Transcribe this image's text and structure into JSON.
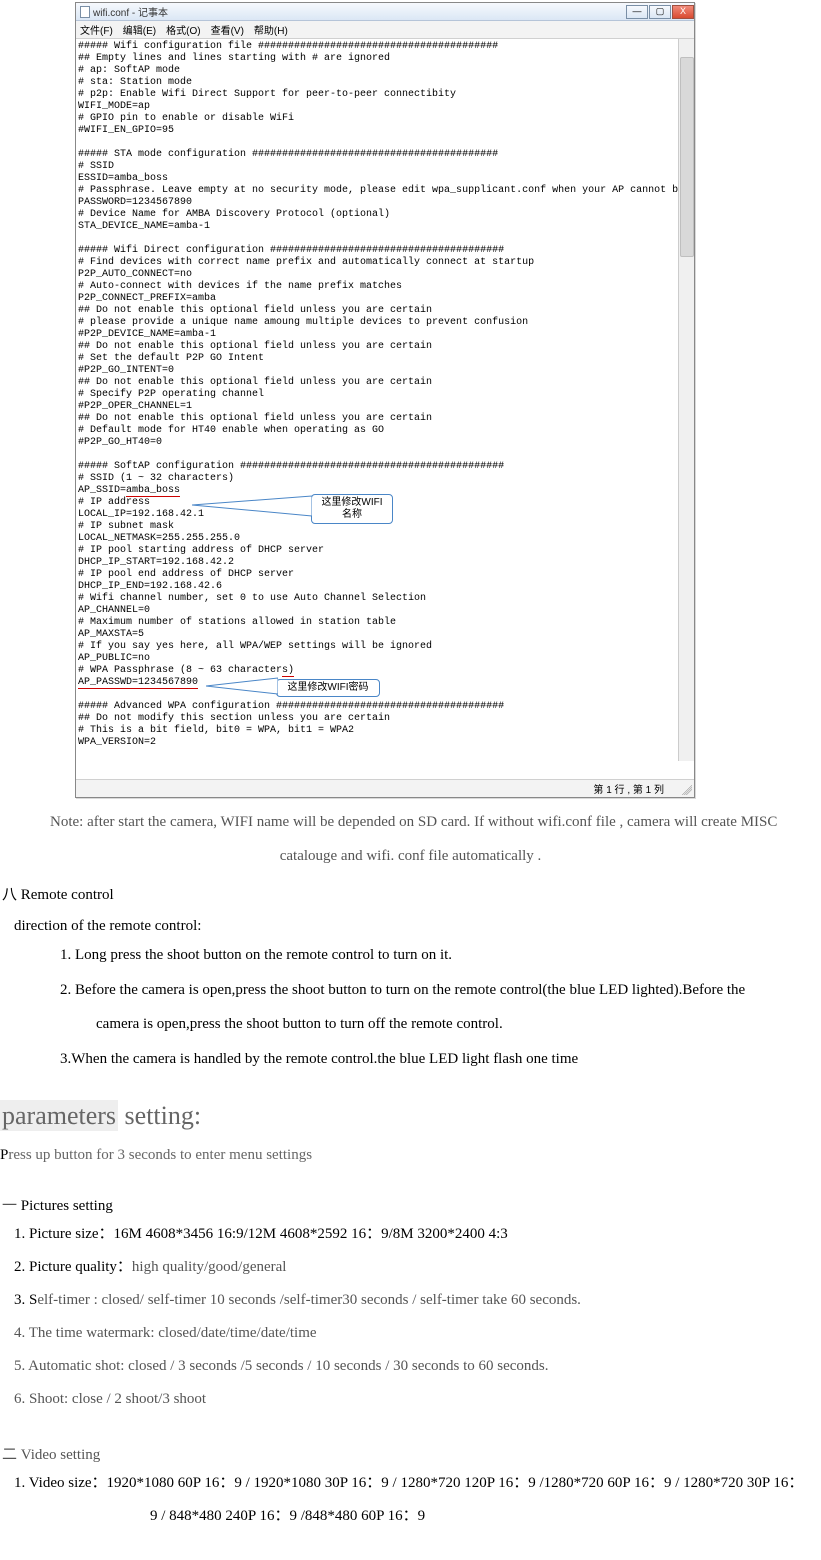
{
  "notepad": {
    "title": "wifi.conf - 记事本",
    "menu": [
      "文件(F)",
      "编辑(E)",
      "格式(O)",
      "查看(V)",
      "帮助(H)"
    ],
    "window_buttons": {
      "min": "—",
      "max": "▢",
      "close": "X"
    },
    "status": "第 1 行 , 第 1 列",
    "callout1": "这里修改WIFI名称",
    "callout2": "这里修改WIFI密码",
    "content_lines": [
      "##### Wifi configuration file ########################################",
      "## Empty lines and lines starting with # are ignored",
      "# ap: SoftAP mode",
      "# sta: Station mode",
      "# p2p: Enable Wifi Direct Support for peer-to-peer connectibity",
      "WIFI_MODE=ap",
      "# GPIO pin to enable or disable WiFi",
      "#WIFI_EN_GPIO=95",
      "",
      "##### STA mode configuration #########################################",
      "# SSID",
      "ESSID=amba_boss",
      "# Passphrase. Leave empty at no security mode, please edit wpa_supplicant.conf when your AP cannot be detected",
      "PASSWORD=1234567890",
      "# Device Name for AMBA Discovery Protocol (optional)",
      "STA_DEVICE_NAME=amba-1",
      "",
      "##### Wifi Direct configuration #######################################",
      "# Find devices with correct name prefix and automatically connect at startup",
      "P2P_AUTO_CONNECT=no",
      "# Auto-connect with devices if the name prefix matches",
      "P2P_CONNECT_PREFIX=amba",
      "## Do not enable this optional field unless you are certain",
      "# please provide a unique name amoung multiple devices to prevent confusion",
      "#P2P_DEVICE_NAME=amba-1",
      "## Do not enable this optional field unless you are certain",
      "# Set the default P2P GO Intent",
      "#P2P_GO_INTENT=0",
      "## Do not enable this optional field unless you are certain",
      "# Specify P2P operating channel",
      "#P2P_OPER_CHANNEL=1",
      "## Do not enable this optional field unless you are certain",
      "# Default mode for HT40 enable when operating as GO",
      "#P2P_GO_HT40=0",
      "",
      "##### SoftAP configuration ############################################",
      "# SSID (1 ~ 32 characters)",
      "AP_SSID=amba_boss",
      "# IP address",
      "LOCAL_IP=192.168.42.1",
      "# IP subnet mask",
      "LOCAL_NETMASK=255.255.255.0",
      "# IP pool starting address of DHCP server",
      "DHCP_IP_START=192.168.42.2",
      "# IP pool end address of DHCP server",
      "DHCP_IP_END=192.168.42.6",
      "# Wifi channel number, set 0 to use Auto Channel Selection",
      "AP_CHANNEL=0",
      "# Maximum number of stations allowed in station table",
      "AP_MAXSTA=5",
      "# If you say yes here, all WPA/WEP settings will be ignored",
      "AP_PUBLIC=no",
      "# WPA Passphrase (8 ~ 63 characters)",
      "AP_PASSWD=1234567890",
      "",
      "##### Advanced WPA configuration ######################################",
      "## Do not modify this section unless you are certain",
      "# This is a bit field, bit0 = WPA, bit1 = WPA2",
      "WPA_VERSION=2"
    ]
  },
  "docbody": {
    "note1": "Note: after start the camera, WIFI name will be depended on SD card. If without wifi.conf file , camera will create MISC",
    "note2": "catalouge and wifi. conf file automatically .",
    "section8": "八  Remote control",
    "direction": "direction of the remote control:",
    "rc1": "1. Long press the shoot button on the remote control to turn on it.",
    "rc2": "2. Before the camera is open,press the shoot button to turn on the remote control(the blue LED lighted).Before the",
    "rc2b": "camera is open,press the shoot button to turn off the remote control.",
    "rc3": "3.When the camera is handled by the remote control.the blue LED light flash one time",
    "params_heading_a": "parameters",
    "params_heading_b": " setting:",
    "press_up": "Press up button for 3 seconds to enter menu settings",
    "pic_section": "一  Pictures setting",
    "pic1": "1. Picture size：16M 4608*3456 16:9/12M 4608*2592 16：9/8M 3200*2400 4:3",
    "pic2a": "2. Picture quality：",
    "pic2b": "high quality/good/general",
    "pic3a": "3. S",
    "pic3b": "elf-timer : closed/ self-timer 10 seconds /self-timer30 seconds / self-timer take 60 seconds.",
    "pic4": "4. The time watermark: closed/date/time/date/time",
    "pic5": "5. Automatic shot: closed / 3 seconds /5 seconds / 10 seconds / 30 seconds to 60 seconds.",
    "pic6": "6. Shoot: close / 2 shoot/3 shoot",
    "vid_section_a": "二  V",
    "vid_section_b": "ideo setting",
    "vid1": "1. Video size：1920*1080 60P 16：9 / 1920*1080 30P 16：9 / 1280*720 120P 16：9 /1280*720 60P 16：9 / 1280*720 30P 16：",
    "vid1b": "9 / 848*480 240P 16：9 /848*480 60P 16：9"
  }
}
